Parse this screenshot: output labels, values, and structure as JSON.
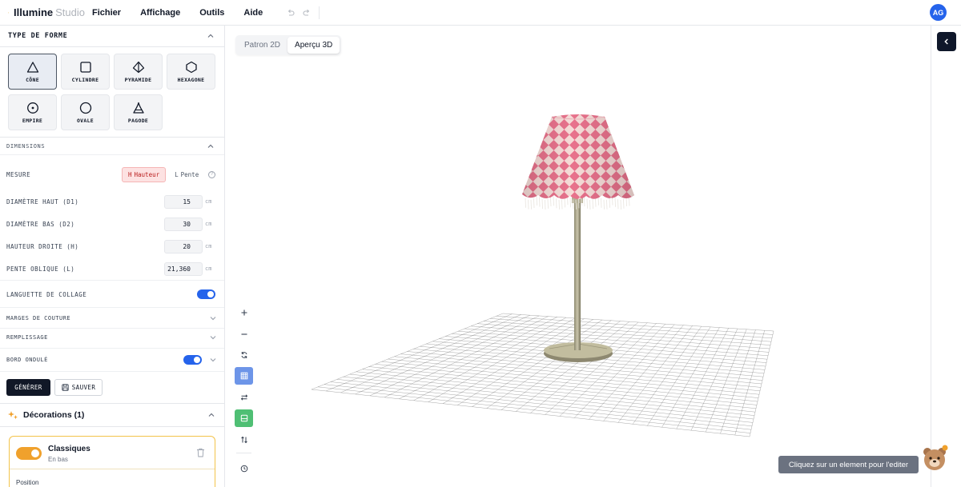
{
  "app": {
    "brand": "Illumine",
    "brand_suffix": "Studio",
    "menu": [
      "Fichier",
      "Affichage",
      "Outils",
      "Aide"
    ],
    "avatar_initials": "AG"
  },
  "left": {
    "shape_type_title": "TYPE DE FORME",
    "shapes": [
      {
        "label": "CÔNE",
        "icon": "triangle-icon",
        "active": true
      },
      {
        "label": "CYLINDRE",
        "icon": "square-icon",
        "active": false
      },
      {
        "label": "PYRAMIDE",
        "icon": "pyramid-icon",
        "active": false
      },
      {
        "label": "HEXAGONE",
        "icon": "hexagon-icon",
        "active": false
      },
      {
        "label": "EMPIRE",
        "icon": "circle-dot-icon",
        "active": false
      },
      {
        "label": "OVALE",
        "icon": "circle-icon",
        "active": false
      },
      {
        "label": "PAGODE",
        "icon": "pagoda-icon",
        "active": false
      }
    ],
    "dimensions_title": "DIMENSIONS",
    "measure": {
      "label": "MESURE",
      "options": [
        {
          "key": "H",
          "label": "Hauteur",
          "selected": true
        },
        {
          "key": "L",
          "label": "Pente",
          "selected": false
        }
      ],
      "help": "?"
    },
    "fields": [
      {
        "label": "DIAMÈTRE HAUT (D1)",
        "value": "15",
        "unit": "cm"
      },
      {
        "label": "DIAMÈTRE BAS (D2)",
        "value": "30",
        "unit": "cm"
      },
      {
        "label": "HAUTEUR DROITE (H)",
        "value": "20",
        "unit": "cm"
      },
      {
        "label": "PENTE OBLIQUE (L)",
        "value": "21,360",
        "unit": "cm"
      }
    ],
    "glue_tab": {
      "label": "LANGUETTE DE COLLAGE",
      "on": true
    },
    "seam_margins": {
      "label": "MARGES DE COUTURE"
    },
    "fill": {
      "label": "REMPLISSAGE"
    },
    "wavy_edge": {
      "label": "BORD ONDULÉ",
      "on": true
    },
    "generate_label": "GÉNÉRER",
    "save_label": "SAUVER",
    "decorations": {
      "title": "Décorations (1)",
      "item": {
        "title": "Classiques",
        "subtitle": "En bas",
        "enabled": true
      },
      "position_label": "Position"
    }
  },
  "viewport": {
    "tabs": [
      {
        "label": "Patron 2D",
        "active": false
      },
      {
        "label": "Aperçu 3D",
        "active": true
      }
    ],
    "tools": [
      "plus-icon",
      "minus-icon",
      "rotate-icon",
      "grid-icon",
      "arrows-horizontal-icon",
      "floor-icon",
      "swap-vertical-icon",
      "clock-icon"
    ],
    "hint": "Cliquez sur un element pour l'editer",
    "colors": {
      "shade_pink": "#e8728c",
      "shade_cream": "#f6dcd8",
      "pole": "#a9a48a",
      "accent": "#2563eb",
      "active_tool": "#6d95e8",
      "floor_tool": "#4fbf74"
    }
  }
}
